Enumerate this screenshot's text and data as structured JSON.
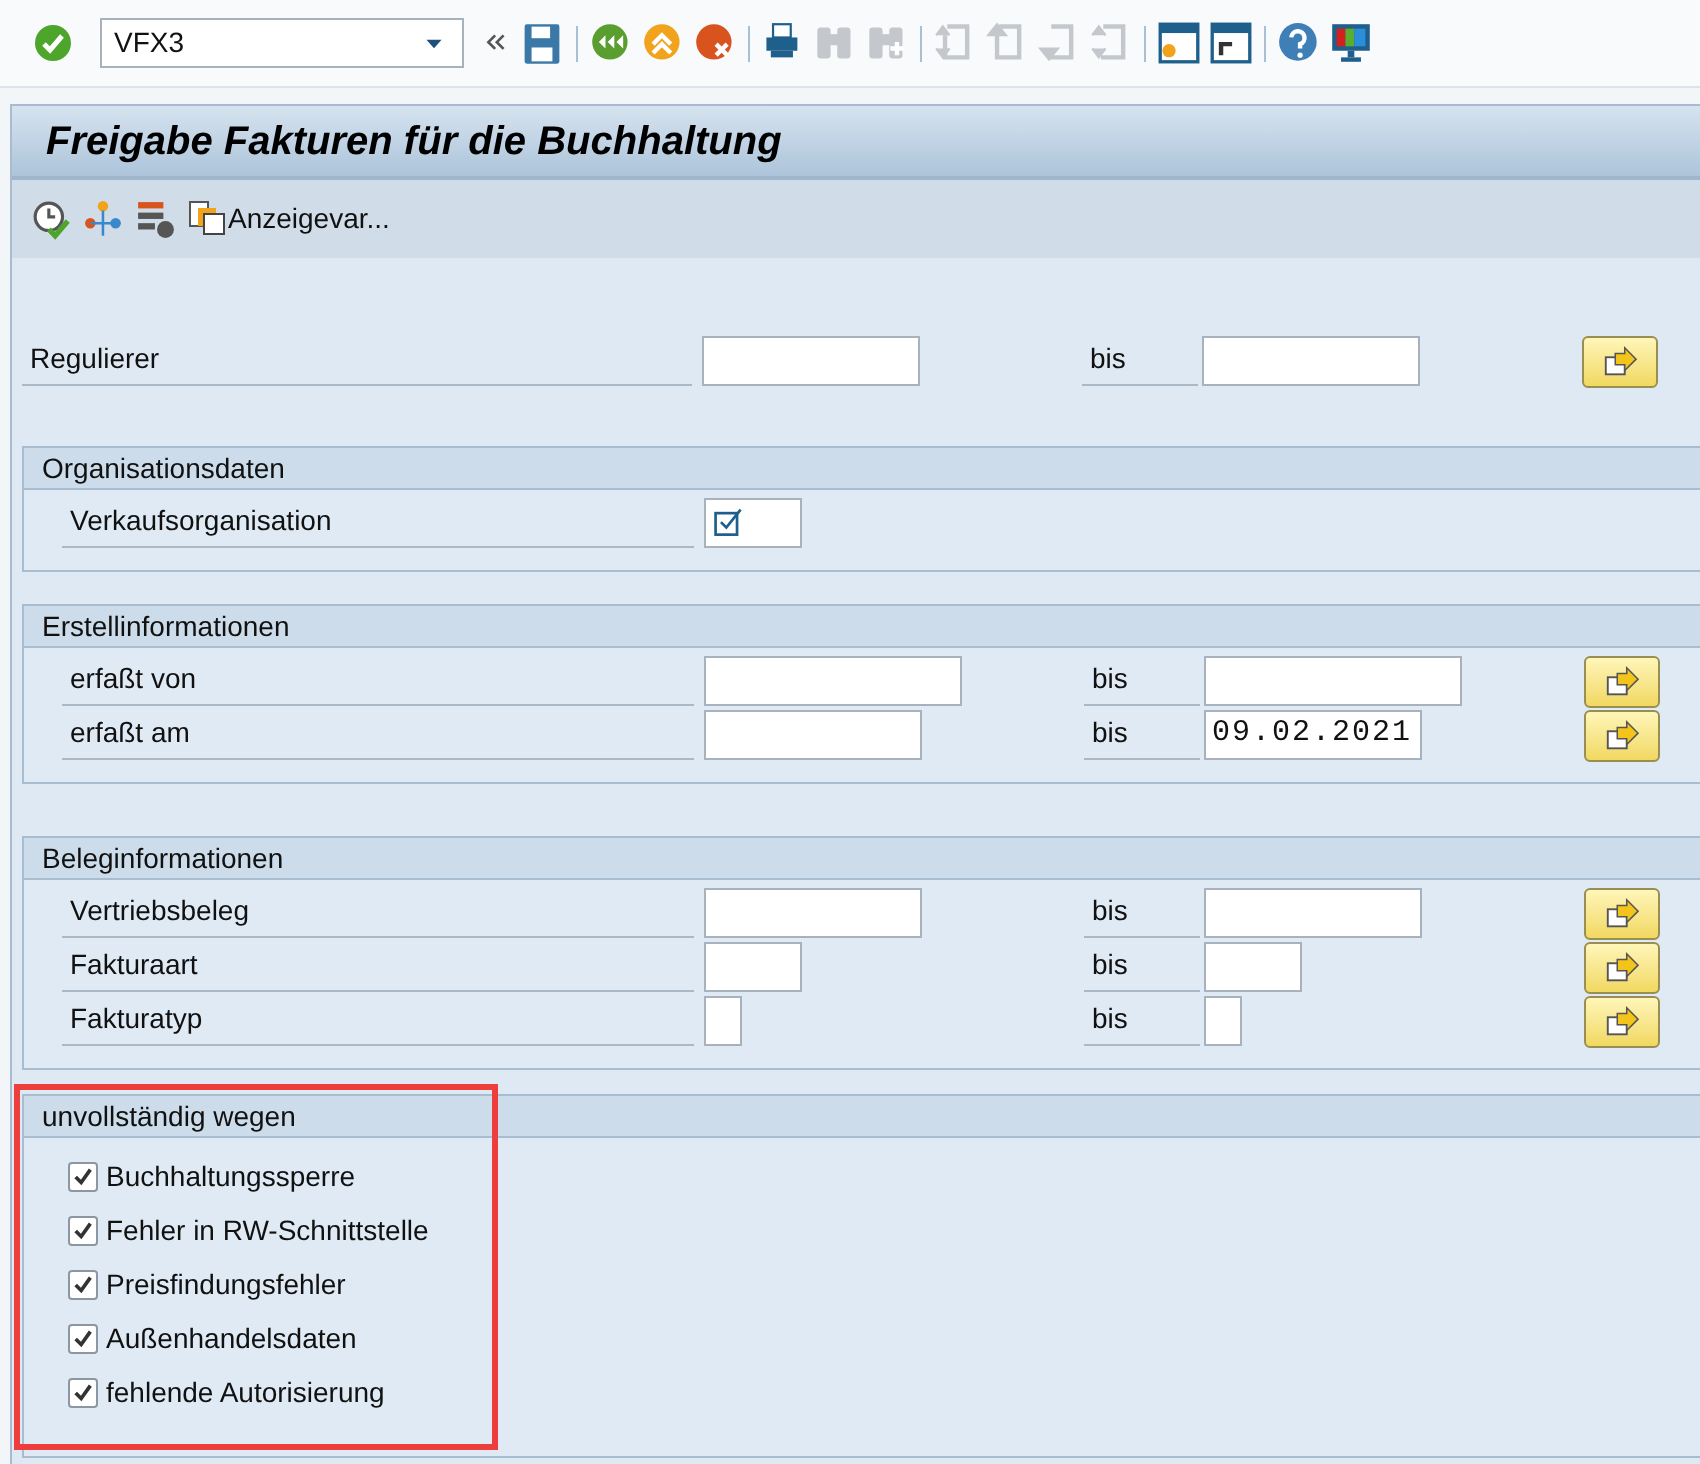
{
  "system_toolbar": {
    "command_field": {
      "value": "VFX3"
    },
    "button_groups": [
      [
        {
          "disabled": false
        }
      ],
      [
        {
          "disabled": false
        },
        {
          "disabled": false
        },
        {
          "disabled": false
        }
      ],
      [
        {
          "disabled": false
        },
        {
          "disabled": true
        },
        {
          "disabled": true
        }
      ],
      [
        {
          "disabled": true
        },
        {
          "disabled": true
        },
        {
          "disabled": true
        },
        {
          "disabled": true
        }
      ],
      [
        {
          "disabled": false
        },
        {
          "disabled": false
        }
      ],
      [
        {
          "disabled": false
        },
        {
          "disabled": false
        }
      ]
    ]
  },
  "title": "Freigabe Fakturen für die Buchhaltung",
  "app_toolbar": {
    "variant_button": {
      "label": "Anzeigevar..."
    }
  },
  "selection_rows": [
    {
      "label": "Regulierer",
      "kind": "medium",
      "to_label": "bis",
      "multi_select": true
    }
  ],
  "sections": [
    {
      "title": "Organisationsdaten",
      "rows": [
        {
          "label": "Verkaufsorganisation",
          "kind": "flag",
          "multi_select": false
        }
      ]
    },
    {
      "title": "Erstellinformationen",
      "rows": [
        {
          "label": "erfaßt von",
          "kind": "long",
          "to_label": "bis",
          "multi_select": true
        },
        {
          "label": "erfaßt am",
          "kind": "medium",
          "to_label": "bis",
          "high_value": "09.02.2021",
          "multi_select": true
        }
      ]
    },
    {
      "title": "Beleginformationen",
      "rows": [
        {
          "label": "Vertriebsbeleg",
          "kind": "medium",
          "to_label": "bis",
          "multi_select": true
        },
        {
          "label": "Fakturaart",
          "kind": "short",
          "to_label": "bis",
          "multi_select": true
        },
        {
          "label": "Fakturatyp",
          "kind": "char",
          "to_label": "bis",
          "multi_select": true
        }
      ]
    }
  ],
  "checkbox_section": {
    "title": "unvollständig wegen",
    "highlighted": true,
    "items": [
      {
        "label": "Buchhaltungssperre",
        "checked": true
      },
      {
        "label": "Fehler in RW-Schnittstelle",
        "checked": true
      },
      {
        "label": "Preisfindungsfehler",
        "checked": true
      },
      {
        "label": "Außenhandelsdaten",
        "checked": true
      },
      {
        "label": "fehlende Autorisierung",
        "checked": true
      }
    ]
  }
}
